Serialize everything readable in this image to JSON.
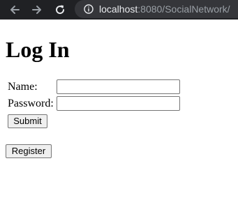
{
  "browser": {
    "url_host": "localhost",
    "url_rest": ":8080/SocialNetwork/"
  },
  "page": {
    "heading": "Log In",
    "form": {
      "name_label": "Name:",
      "name_value": "",
      "password_label": "Password:",
      "password_value": "",
      "submit_label": "Submit"
    },
    "register_label": "Register"
  }
}
